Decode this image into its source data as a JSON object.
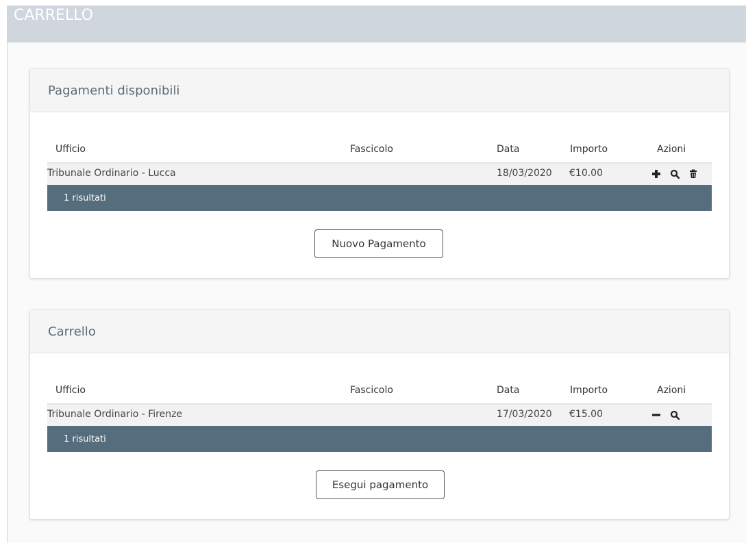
{
  "header": {
    "title": "CARRELLO"
  },
  "colors": {
    "header_bg": "#cfd6dd",
    "footer_bar": "#566d7e",
    "panel_title": "#5a6b7b"
  },
  "available": {
    "title": "Pagamenti disponibili",
    "columns": {
      "ufficio": "Ufficio",
      "fascicolo": "Fascicolo",
      "data": "Data",
      "importo": "Importo",
      "azioni": "Azioni"
    },
    "rows": [
      {
        "ufficio": "Tribunale Ordinario - Lucca",
        "fascicolo": "",
        "data": "18/03/2020",
        "importo": "€10.00",
        "actions": [
          "plus-icon",
          "search-icon",
          "trash-icon"
        ]
      }
    ],
    "results_label": "1 risultati",
    "button_label": "Nuovo Pagamento"
  },
  "cart": {
    "title": "Carrello",
    "columns": {
      "ufficio": "Ufficio",
      "fascicolo": "Fascicolo",
      "data": "Data",
      "importo": "Importo",
      "azioni": "Azioni"
    },
    "rows": [
      {
        "ufficio": "Tribunale Ordinario - Firenze",
        "fascicolo": "",
        "data": "17/03/2020",
        "importo": "€15.00",
        "actions": [
          "minus-icon",
          "search-icon"
        ]
      }
    ],
    "results_label": "1 risultati",
    "button_label": "Esegui pagamento"
  }
}
